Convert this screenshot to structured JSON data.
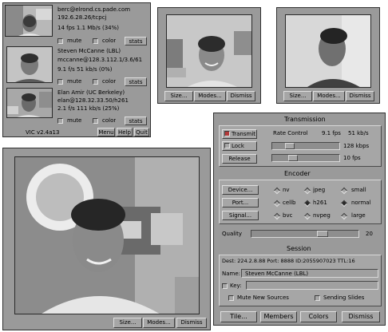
{
  "sources_window": {
    "sources": [
      {
        "line1": "berc@elrond.cs.pade.com",
        "line2": "192.6.28.26/tcpcj",
        "line3": "14 fps   1.1 Mb/s   (34%)"
      },
      {
        "line1": "Steven McCanne (LBL)",
        "line2": "mccanne@128.3.112.1/3.6/61",
        "line3": "9.1 f/s   51 kb/s   (0%)"
      },
      {
        "line1": "Elan Amir (UC Berkeley)",
        "line2": "elan@128.32.33.50/h261",
        "line3": "2.1 f/s   111 kb/s   (25%)"
      }
    ],
    "row_controls": {
      "mute": "mute",
      "color": "color",
      "stats": "stats"
    },
    "footer": {
      "title": "VIC v2.4a13",
      "menu": "Menu",
      "help": "Help",
      "quit": "Quit"
    }
  },
  "small_video_windows": [
    {
      "size": "Size...",
      "modes": "Modes...",
      "dismiss": "Dismiss"
    },
    {
      "size": "Size...",
      "modes": "Modes...",
      "dismiss": "Dismiss"
    }
  ],
  "large_video_window": {
    "size": "Size...",
    "modes": "Modes...",
    "dismiss": "Dismiss"
  },
  "menu_panel": {
    "transmission": {
      "title": "Transmission",
      "transmit": "Transmit",
      "release": "Release",
      "lock": "Lock",
      "rate_control": "Rate Control",
      "rate_fps": "9.1 fps",
      "rate_kbps": "51 kb/s",
      "bandwidth": "128 kbps",
      "frame_rate": "10 fps",
      "bandwidth_fraction": 0.22,
      "framerate_fraction": 0.28
    },
    "encoder": {
      "title": "Encoder",
      "device": "Device...",
      "port": "Port...",
      "signal": "Signal...",
      "formats": [
        "nv",
        "cellb",
        "bvc",
        "jpeg",
        "h261",
        "nvpeg"
      ],
      "sizes": [
        "small",
        "normal",
        "large"
      ],
      "selected_format": "h261",
      "selected_size": "normal",
      "quality_label": "Quality",
      "quality_value": "20",
      "quality_fraction": 0.68
    },
    "session": {
      "title": "Session",
      "info": "Dest: 224.2.8.88   Port: 8888  ID:2055907023  TTL:16",
      "name_label": "Name:",
      "name_value": "Steven McCanne (LBL)",
      "key_label": "Key:",
      "key_value": "",
      "mute_new": "Mute New Sources",
      "sending_slides": "Sending Slides"
    },
    "buttons": {
      "tile": "Tile...",
      "members": "Members",
      "colors": "Colors",
      "dismiss": "Dismiss"
    }
  },
  "colors": {
    "chrome": "#9a9a9a",
    "active_check": "#b23a3a"
  }
}
